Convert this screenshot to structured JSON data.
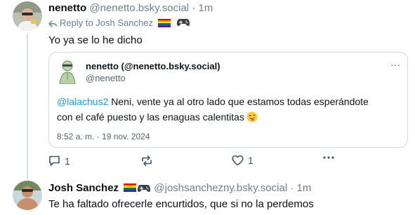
{
  "post1": {
    "author_name": "nenetto",
    "author_handle": "@nenetto.bsky.social",
    "separator": "·",
    "time": "1m",
    "reply_to": "Reply to Josh Sanchez",
    "text": "Yo ya se lo he dicho",
    "embed": {
      "name": "nenetto (@nenetto.bsky.social)",
      "handle": "@nenetto",
      "more": "···",
      "mention": "@lalachus2",
      "text_line1": " Neni, vente ya al otro lado que estamos todas esperándote",
      "text_line2": "con el café puesto y las enaguas calentitas",
      "date": "8:52 a. m. · 19 nov. 2024"
    },
    "actions": {
      "reply_count": "1",
      "like_count": "1"
    }
  },
  "post2": {
    "author_name": "Josh Sanchez",
    "author_handle": "@joshsanchezny.bsky.social",
    "separator": "·",
    "time": "1m",
    "text": "Te ha faltado ofrecerle encurtidos, que si no la perdemos"
  },
  "icons": {
    "reply_arrow": "reply-arrow-icon",
    "flag": "rainbow-flag-icon",
    "gamepad": "gamepad-icon",
    "comment": "comment-icon",
    "repost": "repost-icon",
    "like": "heart-icon",
    "more": "more-dots-icon",
    "emoji": "winking-tongue-face-icon"
  },
  "colors": {
    "link": "#1d9bf0",
    "muted": "#6f7f8f",
    "thread_line": "#d4dbe2"
  }
}
